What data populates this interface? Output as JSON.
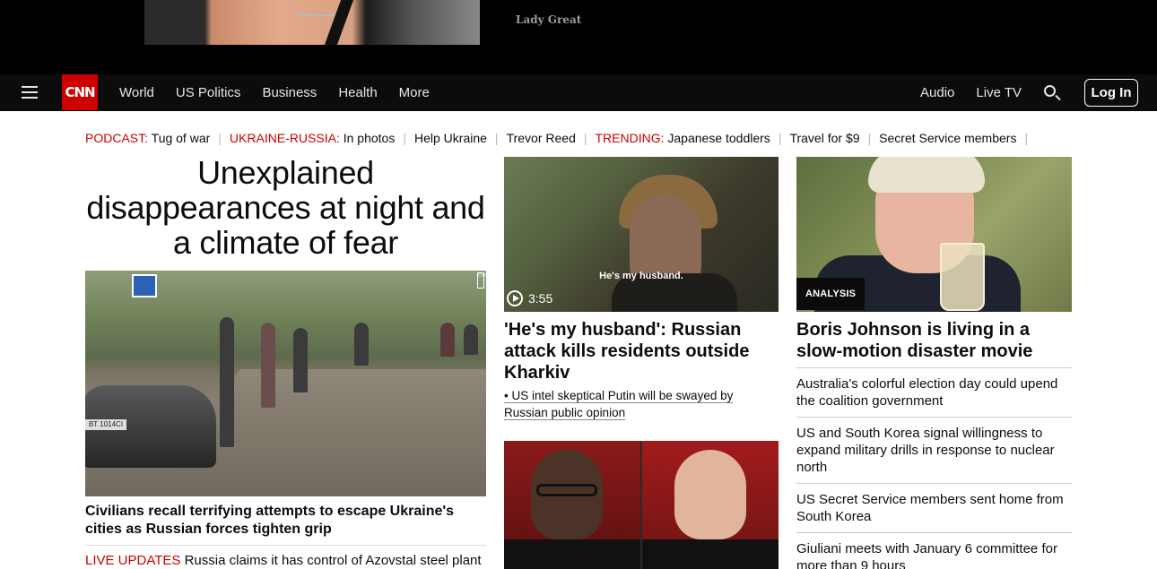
{
  "ad": {
    "text": "Lady Great"
  },
  "nav": {
    "logo": "CNN",
    "links": [
      "World",
      "US Politics",
      "Business",
      "Health",
      "More"
    ],
    "right_links": [
      "Audio",
      "Live TV"
    ],
    "login_label": "Log In"
  },
  "trending": {
    "items": [
      {
        "label": "PODCAST:",
        "text": "Tug of war"
      },
      {
        "label": "UKRAINE-RUSSIA:",
        "text": "In photos"
      },
      {
        "label": "",
        "text": "Help Ukraine"
      },
      {
        "label": "",
        "text": "Trevor Reed"
      },
      {
        "label": "TRENDING:",
        "text": "Japanese toddlers"
      },
      {
        "label": "",
        "text": "Travel for $9"
      },
      {
        "label": "",
        "text": "Secret Service members"
      }
    ]
  },
  "main": {
    "headline": "Unexplained disappearances at night and a climate of fear",
    "plate_text": "BT 1014CI",
    "bug_text": "CNN",
    "story_title": "Civilians recall terrifying attempts to escape Ukraine's cities as Russian forces tighten grip",
    "live_label": "LIVE UPDATES",
    "live_text": " Russia claims it has control of Azovstal steel plant"
  },
  "middle": {
    "video_caption": "He's my husband.",
    "duration": "3:55",
    "title": "'He's my husband': Russian attack kills residents outside Kharkiv",
    "sub_link": "• US intel skeptical Putin will be swayed by Russian public opinion"
  },
  "right": {
    "badge": "ANALYSIS",
    "title": "Boris Johnson is living in a slow-motion disaster movie",
    "items": [
      "Australia's colorful election day could upend the coalition government",
      "US and South Korea signal willingness to expand military drills in response to nuclear north",
      "US Secret Service members sent home from South Korea",
      "Giuliani meets with January 6 committee for more than 9 hours"
    ]
  },
  "colors": {
    "brand": "#cc0000",
    "nav_bg": "#0c0c0c"
  },
  "icons": [
    "hamburger-icon",
    "search-icon",
    "play-icon"
  ]
}
